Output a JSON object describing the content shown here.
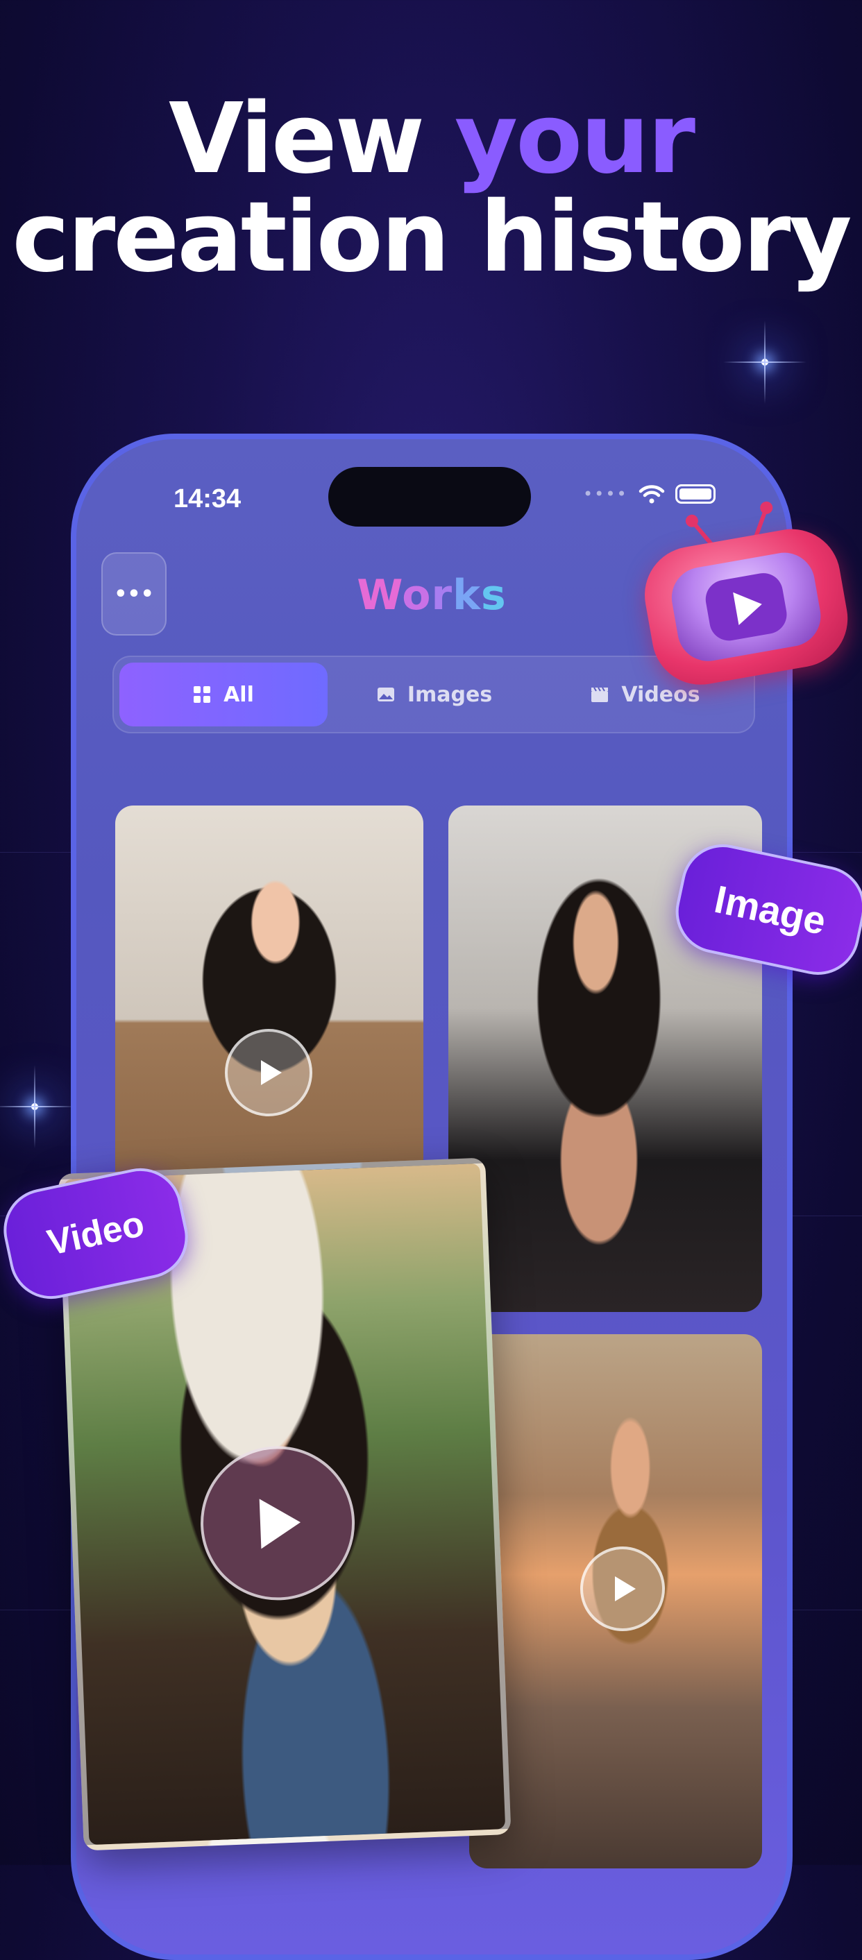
{
  "headline": {
    "line1_plain": "View",
    "line1_accent": "your",
    "line2": "creation history"
  },
  "status_bar": {
    "time": "14:34"
  },
  "app": {
    "title_letters": [
      "W",
      "o",
      "r",
      "k",
      "s"
    ],
    "menu_label": "•••"
  },
  "tabs": [
    {
      "label": "All",
      "icon": "grid-icon",
      "active": true
    },
    {
      "label": "Images",
      "icon": "image-icon",
      "active": false
    },
    {
      "label": "Videos",
      "icon": "clapper-icon",
      "active": false
    }
  ],
  "badges": {
    "image": "Image",
    "video": "Video"
  },
  "colors": {
    "accent": "#8a5cff",
    "tab_active": "#7d66ff",
    "badge": "#7a26e0",
    "tv": "#e8356a"
  }
}
